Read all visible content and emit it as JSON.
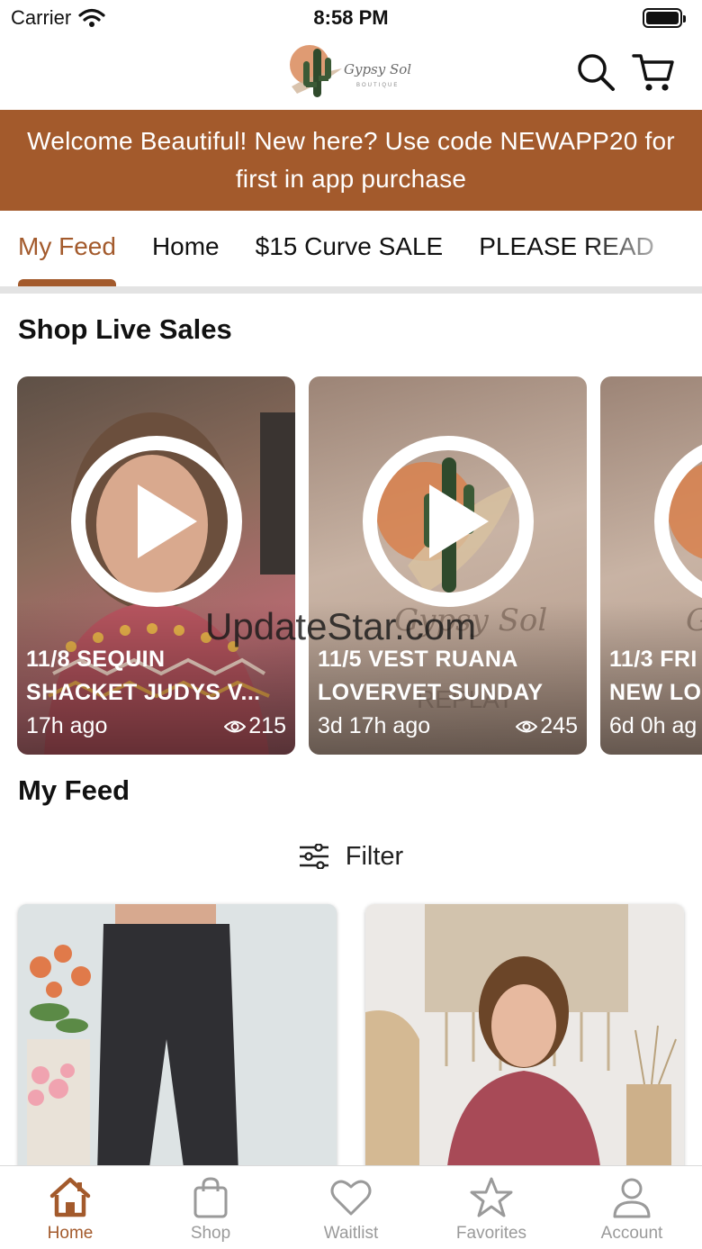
{
  "status_bar": {
    "carrier": "Carrier",
    "time": "8:58 PM"
  },
  "header": {
    "logo_text": "Gypsy Sol",
    "logo_subtext": "BOUTIQUE",
    "search_icon": "search-icon",
    "cart_icon": "cart-icon"
  },
  "promo": {
    "line1": "Welcome Beautiful! New here? Use code NEWAPP20 for",
    "line2": "first in app purchase"
  },
  "tabs": [
    {
      "label": "My Feed",
      "active": true
    },
    {
      "label": "Home"
    },
    {
      "label": "$15 Curve SALE"
    },
    {
      "label": "PLEASE READ"
    }
  ],
  "live_sales": {
    "title": "Shop Live Sales",
    "cards": [
      {
        "line1": "11/8 SEQUIN",
        "line2": "SHACKET JUDYS V...",
        "time": "17h ago",
        "views": "215"
      },
      {
        "line1": "11/5 VEST RUANA",
        "line2": "LOVERVET SUNDAY",
        "time": "3d 17h ago",
        "views": "245"
      },
      {
        "line1": "11/3 FRI",
        "line2": "NEW LO",
        "time": "6d 0h ag",
        "views": ""
      }
    ]
  },
  "watermark": "UpdateStar.com",
  "my_feed": {
    "title": "My Feed",
    "filter_label": "Filter"
  },
  "bottom_nav": [
    {
      "label": "Home",
      "icon": "home-icon",
      "active": true
    },
    {
      "label": "Shop",
      "icon": "shopping-bag-icon"
    },
    {
      "label": "Waitlist",
      "icon": "heart-icon"
    },
    {
      "label": "Favorites",
      "icon": "star-icon"
    },
    {
      "label": "Account",
      "icon": "person-icon"
    }
  ],
  "colors": {
    "brand": "#a35a2c",
    "nav_inactive": "#9a9a9a"
  }
}
